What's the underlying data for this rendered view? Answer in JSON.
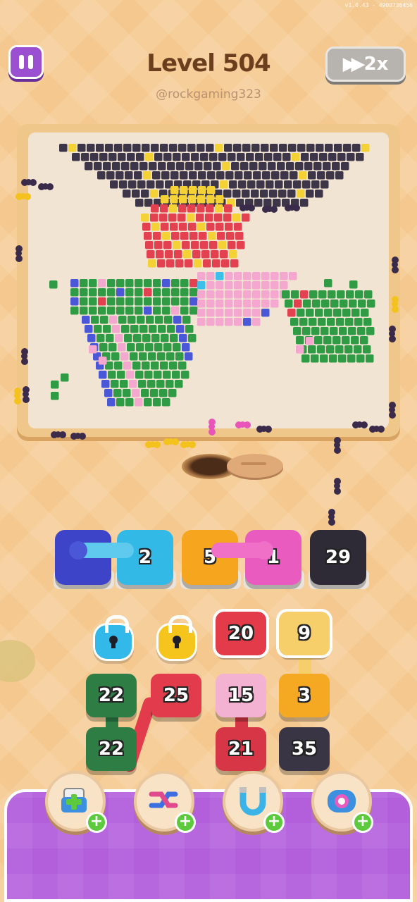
{
  "version": "v1.0.43 - 4908736456",
  "header": {
    "level_title": "Level 504",
    "username": "@rockgaming323",
    "speed_label": "2x"
  },
  "slots": [
    {
      "color": "#3e44c8",
      "label": ""
    },
    {
      "color": "#32b9e6",
      "label": "2"
    },
    {
      "color": "#f6a51f",
      "label": "5"
    },
    {
      "color": "#ea5bc0",
      "label": "1"
    },
    {
      "color": "#2e2a36",
      "label": "29"
    }
  ],
  "locks": [
    {
      "color": "#33b8ea"
    },
    {
      "color": "#f5c51d"
    }
  ],
  "tiles": [
    {
      "label": "20",
      "color": "#e43b4a"
    },
    {
      "label": "9",
      "color": "#f7cf6a"
    },
    {
      "label": "22",
      "color": "#2e7d44"
    },
    {
      "label": "25",
      "color": "#e23b4b"
    },
    {
      "label": "15",
      "color": "#f4b2d2"
    },
    {
      "label": "3",
      "color": "#f5a923"
    },
    {
      "label": "22",
      "color": "#2e7d44"
    },
    {
      "label": "21",
      "color": "#d63645"
    },
    {
      "label": "35",
      "color": "#3a3545"
    }
  ],
  "boosters": [
    {
      "icon": "add-slot-icon"
    },
    {
      "icon": "shuffle-icon"
    },
    {
      "icon": "magnet-icon"
    },
    {
      "icon": "donut-icon"
    }
  ],
  "colors": {
    "dark": "#3d3548",
    "yellow": "#f4d235",
    "red": "#e34150",
    "pink": "#f4a7cf",
    "green": "#2f9b45",
    "blue": "#4a57d6",
    "cyan": "#3cc0ea",
    "orange": "#f5a62b"
  }
}
